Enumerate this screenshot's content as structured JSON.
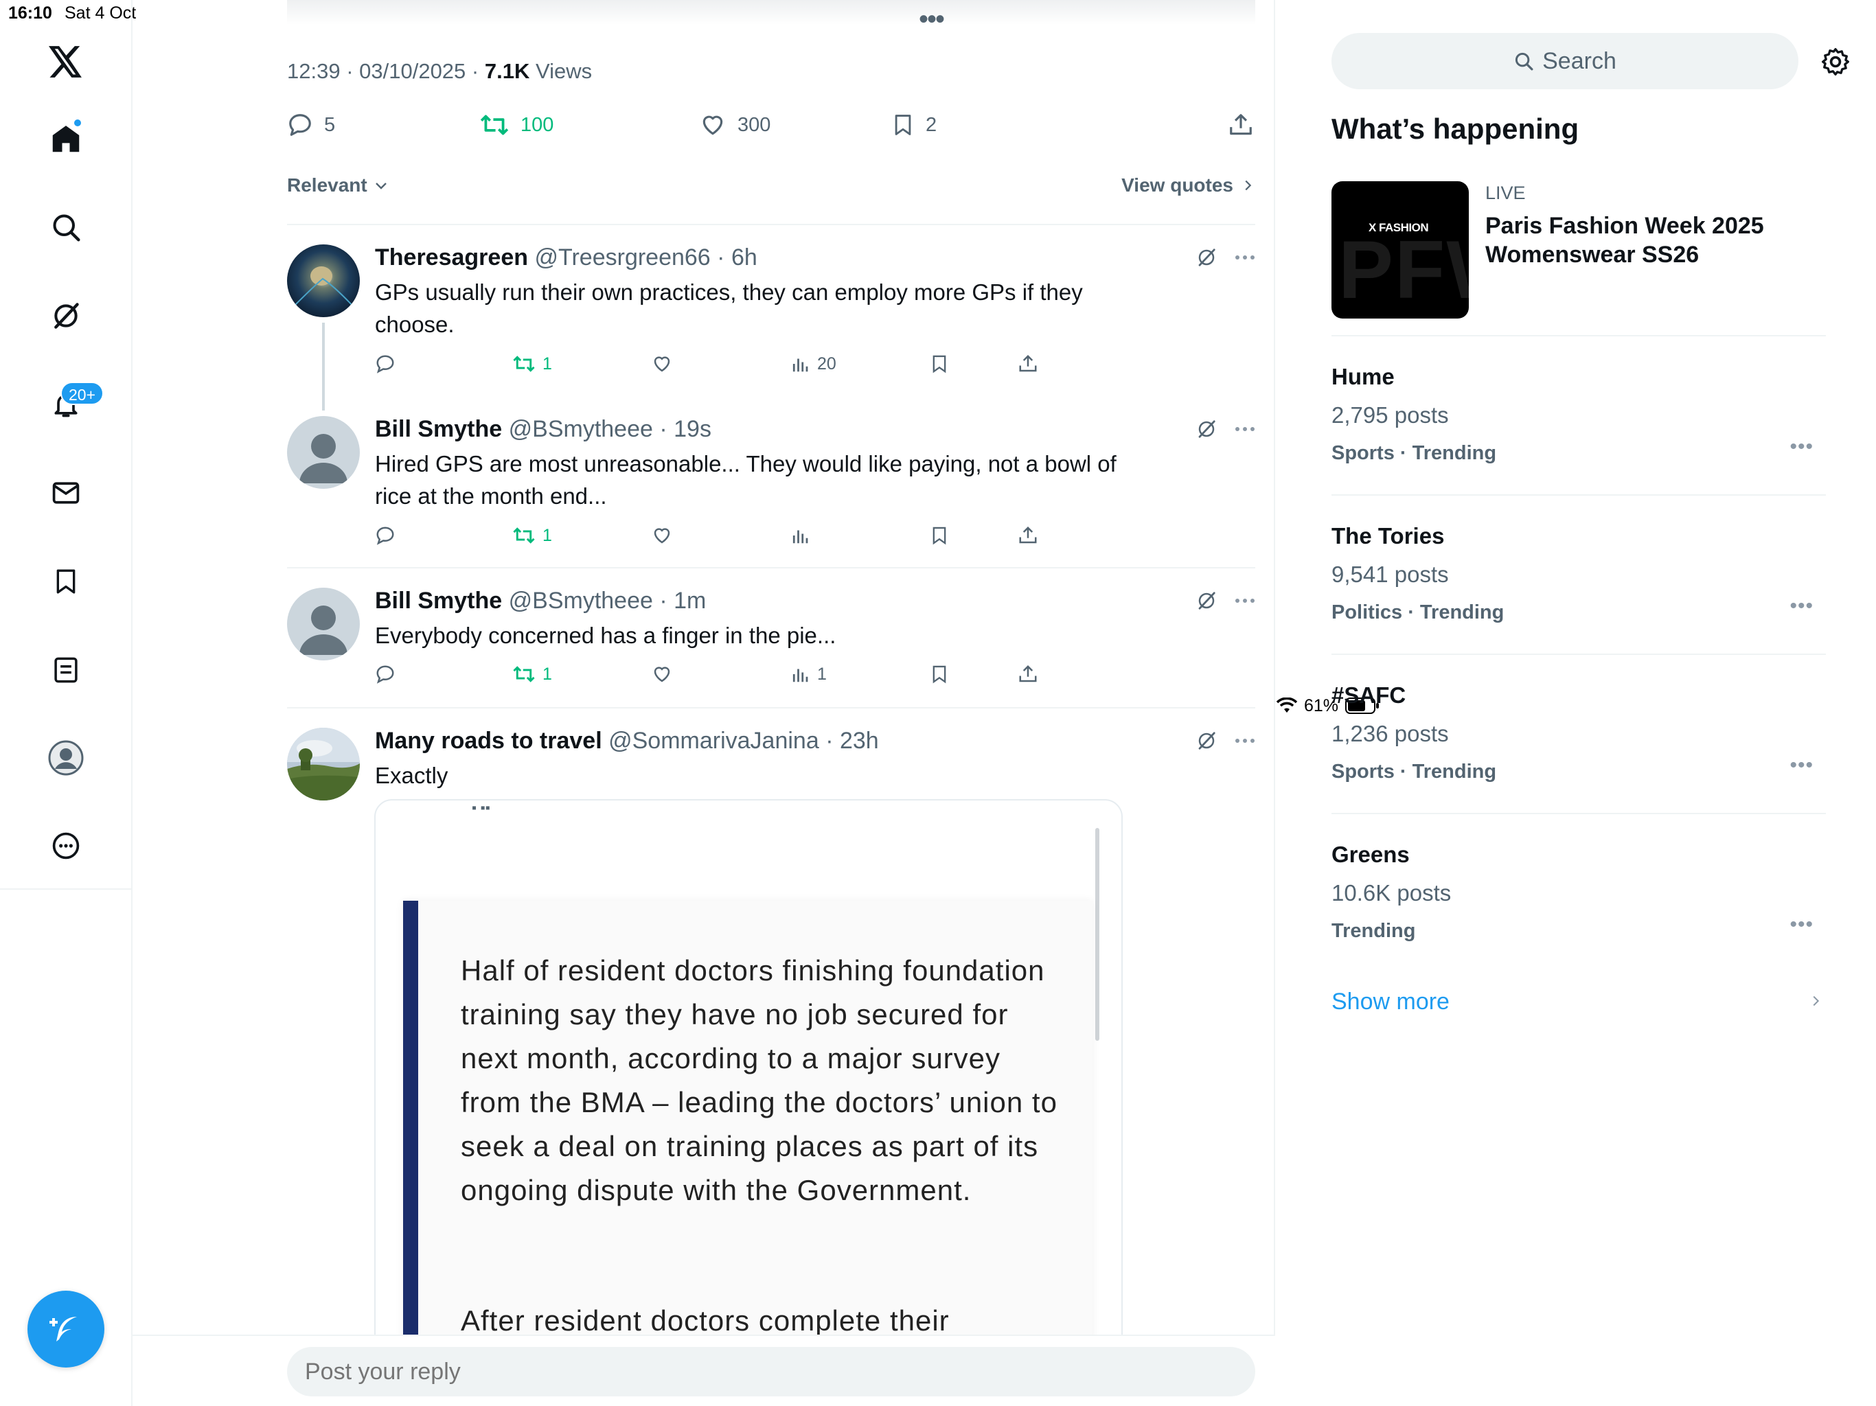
{
  "status_bar": {
    "time": "16:10",
    "date": "Sat 4 Oct",
    "battery": "61%"
  },
  "nav": {
    "notifications_badge": "20+",
    "icons": [
      "x-logo-icon",
      "home-icon",
      "search-icon",
      "grok-icon",
      "bell-icon",
      "mail-icon",
      "bookmark-icon",
      "list-icon",
      "profile-icon",
      "more-icon"
    ]
  },
  "tweet": {
    "time": "12:39",
    "date": "03/10/2025",
    "views_count": "7.1K",
    "views_label": "Views",
    "replies": "5",
    "reposts": "100",
    "likes": "300",
    "bookmarks": "2"
  },
  "sort": {
    "label": "Relevant",
    "view_quotes": "View quotes"
  },
  "replies": [
    {
      "name": "Theresagreen",
      "handle": "@Treesrgreen66",
      "time": "6h",
      "text": "GPs usually run their own practices, they can employ more GPs if they choose.",
      "reposts": "1",
      "views": "20"
    },
    {
      "name": "Bill Smythe",
      "handle": "@BSmytheee",
      "time": "19s",
      "text": "Hired GPS are most unreasonable... They would like paying, not a bowl of rice at the month end...",
      "reposts": "1",
      "views": ""
    },
    {
      "name": "Bill Smythe",
      "handle": "@BSmytheee",
      "time": "1m",
      "text": "Everybody concerned has a finger in the pie...",
      "reposts": "1",
      "views": "1"
    },
    {
      "name": "Many roads to travel",
      "handle": "@SommarivaJanina",
      "time": "23h",
      "text": "Exactly"
    }
  ],
  "quote": {
    "paragraph1": "Half of resident doctors finishing foundation training say they have no job secured for next month, according to a major survey from the BMA – leading the doctors’ union to seek a deal on training places as part of its ongoing dispute with the Government.",
    "paragraph2": "After resident doctors complete their"
  },
  "reply_box": {
    "placeholder": "Post your reply"
  },
  "sidebar": {
    "search_placeholder": "Search",
    "section_title": "What’s happening",
    "live": {
      "label": "LIVE",
      "title": "Paris Fashion Week 2025 Womenswear SS26",
      "thumb_brand": "X FASHION",
      "thumb_text": "PFW"
    },
    "trends": [
      {
        "title": "Hume",
        "count": "2,795 posts",
        "meta": "Sports · Trending"
      },
      {
        "title": "The Tories",
        "count": "9,541 posts",
        "meta": "Politics · Trending"
      },
      {
        "title": "#SAFC",
        "count": "1,236 posts",
        "meta": "Sports · Trending"
      },
      {
        "title": "Greens",
        "count": "10.6K posts",
        "meta": "Trending"
      }
    ],
    "show_more": "Show more"
  },
  "colors": {
    "accent": "#1d9bf0",
    "repost_green": "#00ba7c",
    "muted": "#536471",
    "quote_bar": "#1b2d6b"
  }
}
